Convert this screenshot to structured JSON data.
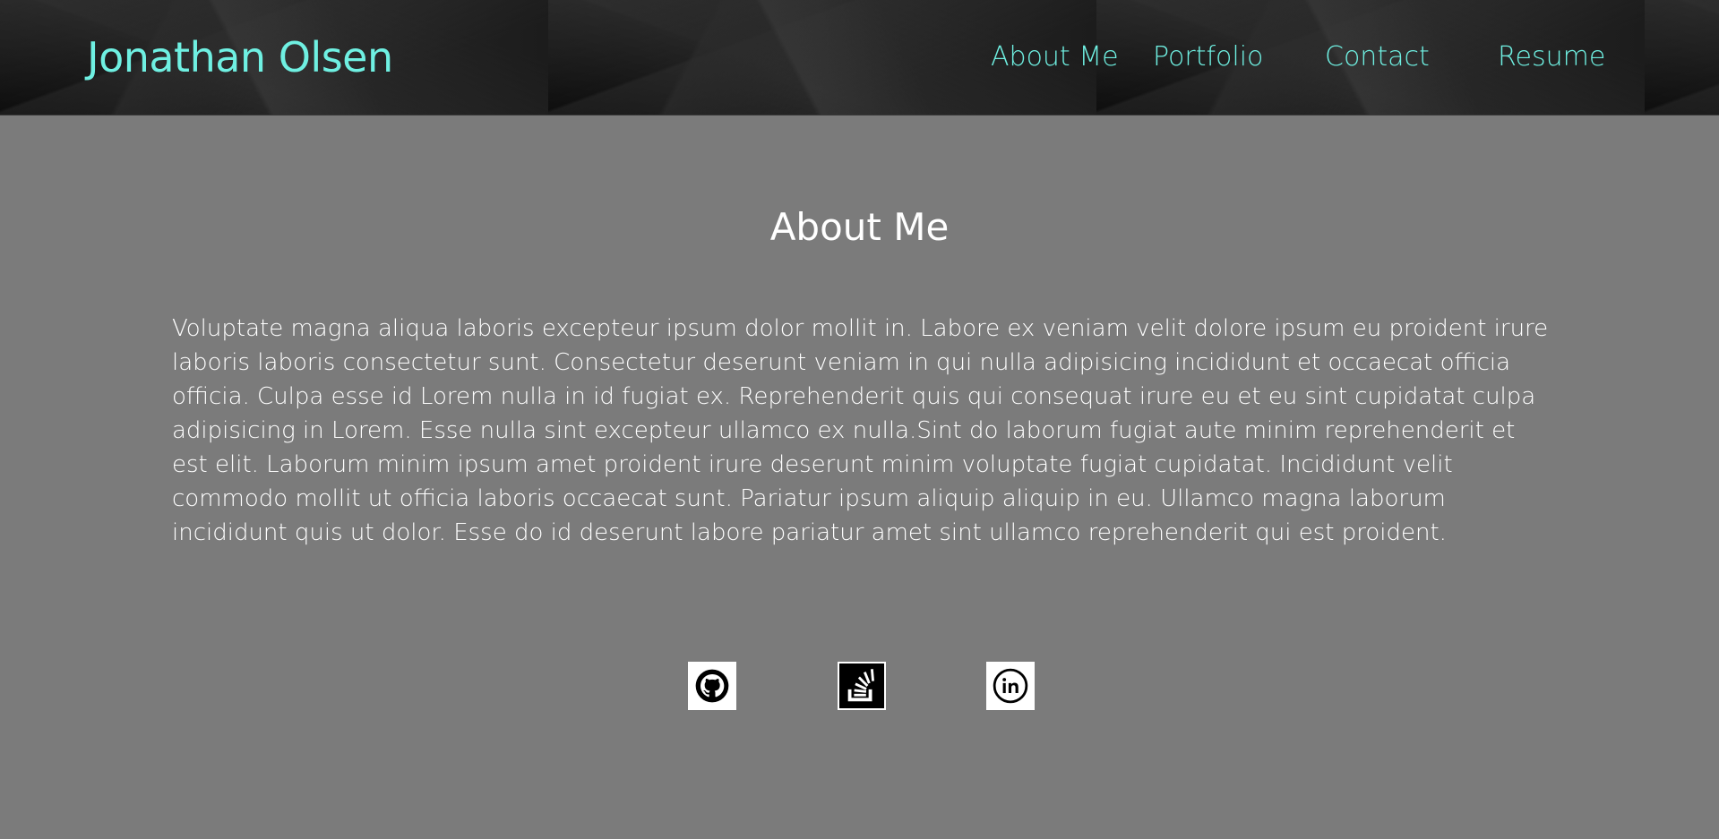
{
  "header": {
    "brand": "Jonathan Olsen",
    "nav": [
      {
        "label": "About Me"
      },
      {
        "label": "Portfolio"
      },
      {
        "label": "Contact"
      },
      {
        "label": "Resume"
      }
    ],
    "accent_color": "#6ff0e2"
  },
  "main": {
    "title": "About Me",
    "bio": "Voluptate magna aliqua laboris excepteur ipsum dolor mollit in. Labore ex veniam velit dolore ipsum eu proident irure laboris laboris consectetur sunt. Consectetur deserunt veniam in qui nulla adipisicing incididunt et occaecat officia officia. Culpa esse id Lorem nulla in id fugiat ex. Reprehenderit quis qui consequat irure eu et eu sint cupidatat culpa adipisicing in Lorem. Esse nulla sint excepteur ullamco ex nulla.Sint do laborum fugiat aute minim reprehenderit et est elit. Laborum minim ipsum amet proident irure deserunt minim voluptate fugiat cupidatat. Incididunt velit commodo mollit ut officia laboris occaecat sunt. Pariatur ipsum aliquip aliquip in eu. Ullamco magna laborum incididunt quis ut dolor. Esse do id deserunt labore pariatur amet sint ullamco reprehenderit qui est proident.",
    "background_color": "#7b7b7b"
  },
  "social": [
    {
      "icon": "github-icon"
    },
    {
      "icon": "stack-overflow-icon"
    },
    {
      "icon": "linkedin-icon"
    }
  ]
}
